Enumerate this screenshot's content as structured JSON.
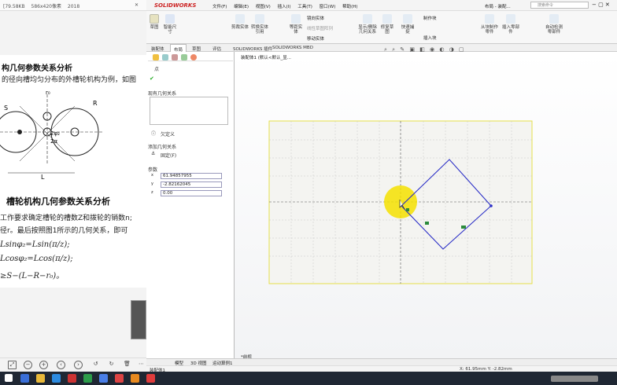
{
  "viewer": {
    "title_parts": [
      "[79.58KB",
      "586x420像素",
      "2018"
    ],
    "doc": {
      "heading": "构几何参数关系分析",
      "line1": "的径向槽均匀分布的外槽轮机构为例，如图",
      "caption": "槽轮机构几何参数关系分析",
      "line2": "工作要求确定槽轮的槽数Z和拨轮的销数n;",
      "line3": "径r。最后按照图1所示的几何关系，即可",
      "formula1": "Lsinφ₂=Lsin(π/z);",
      "formula2": "Lcosφ₂=Lcos(π/z);",
      "formula3": "≥S−(L−R−r₀)。",
      "fig_labels": {
        "r0": "r₀",
        "R": "R",
        "S": "S",
        "L": "L",
        "two_phi": "2φ₂",
        "two_alpha": "2α"
      }
    },
    "toolbar_icons": [
      "fit-icon",
      "zoom-out-icon",
      "zoom-in-icon",
      "prev-icon",
      "next-icon",
      "rotate-left-icon",
      "rotate-right-icon",
      "delete-icon",
      "more-icon"
    ]
  },
  "sw": {
    "logo": "SOLIDWORKS",
    "menus": [
      "文件(F)",
      "编辑(E)",
      "视图(V)",
      "插入(I)",
      "工具(T)",
      "窗口(W)",
      "帮助(H)"
    ],
    "title_right": "布局 - 装配...",
    "search_placeholder": "搜索命令",
    "ribbon": {
      "b1": "草图",
      "b2": "智能尺寸",
      "b3": "剪裁实体",
      "b4": "转换实体引用",
      "b5": "等距实体",
      "b6": "镜向实体",
      "b7": "线性草图阵列",
      "b8": "移动实体",
      "b9": "显示/删除几何关系",
      "b10": "修复草图",
      "b11": "快速捕捉",
      "b12": "制作块",
      "b13": "插入块",
      "b14": "从块制作零件",
      "b15": "插入零部件",
      "b16": "自动检测零部件"
    },
    "tabs": [
      "装配体",
      "布局",
      "草图",
      "评估",
      "SOLIDWORKS 插件",
      "SOLIDWORKS MBD"
    ],
    "tree_label": "装配体1 (默认<默认_显...",
    "pm": {
      "title": "点",
      "existing_rel": "现有几何关系",
      "under_defined": "欠定义",
      "add_rel": "添加几何关系",
      "fix": "固定(F)",
      "params": "参数",
      "x_value": "61.94857955",
      "y_value": "-2.82162045",
      "z_value": "0.00"
    },
    "gfx_label": "*前视",
    "bottom_tabs": [
      "模型",
      "3D 视图",
      "运动算例1"
    ],
    "status_left": "装配体1",
    "status_right": "X: 61.95mm Y: -2.82mm"
  },
  "colors": {
    "sketch": "#2b2fc7",
    "highlight": "#f4e000",
    "accent": "#cc2222"
  }
}
